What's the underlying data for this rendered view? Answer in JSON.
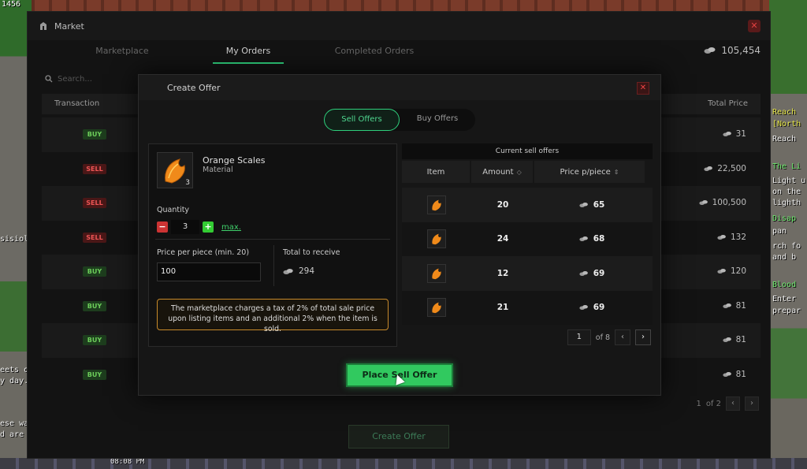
{
  "market": {
    "title": "Market",
    "tabs": [
      "Marketplace",
      "My Orders",
      "Completed Orders"
    ],
    "coin_total": "105,454",
    "search_placeholder": "Search...",
    "col_transaction": "Transaction",
    "col_total_price": "Total Price",
    "rows": [
      {
        "type": "BUY",
        "total": "31"
      },
      {
        "type": "SELL",
        "total": "22,500"
      },
      {
        "type": "SELL",
        "total": "100,500"
      },
      {
        "type": "SELL",
        "total": "132"
      },
      {
        "type": "BUY",
        "total": "120"
      },
      {
        "type": "BUY",
        "total": "81"
      },
      {
        "type": "BUY",
        "total": "81"
      },
      {
        "type": "BUY",
        "total": "81"
      }
    ],
    "page": "1",
    "page_of": "of 2",
    "create_offer_label": "Create Offer"
  },
  "modal": {
    "title": "Create Offer",
    "toggle_sell": "Sell Offers",
    "toggle_buy": "Buy Offers",
    "item": {
      "name": "Orange Scales",
      "category": "Material",
      "stack": "3"
    },
    "quantity_label": "Quantity",
    "quantity_value": "3",
    "max_label": "max.",
    "price_label": "Price per piece (min. 20)",
    "price_value": "100",
    "receive_label": "Total to receive",
    "receive_value": "294",
    "tax_note": "The marketplace charges a tax of 2% of total sale price upon listing items and an additional 2% when the item is sold.",
    "offers": {
      "title": "Current sell offers",
      "col_item": "Item",
      "col_amount": "Amount",
      "col_price": "Price p/piece",
      "rows": [
        {
          "amount": "20",
          "price": "65"
        },
        {
          "amount": "24",
          "price": "68"
        },
        {
          "amount": "12",
          "price": "69"
        },
        {
          "amount": "21",
          "price": "69"
        }
      ],
      "page": "1",
      "page_of": "of 8"
    },
    "place_label": "Place Sell Offer"
  },
  "colors": {
    "accent": "#2ecf7c",
    "buy": "#6ccd5a",
    "sell": "#ee5555",
    "tax_border": "#c88a2a"
  },
  "background_text": {
    "right": [
      "Reach",
      "[North",
      "Reach",
      "The Li",
      "Light u",
      "on the",
      "lighth",
      "Disap",
      "pan",
      "rch fo",
      "and b",
      "Blood",
      "Enter",
      "prepar"
    ],
    "left": [
      "sisiolg",
      "eets of",
      "y day.",
      "ese wal",
      "d are e"
    ],
    "clock": "08:08 PM",
    "corner": "1456"
  }
}
